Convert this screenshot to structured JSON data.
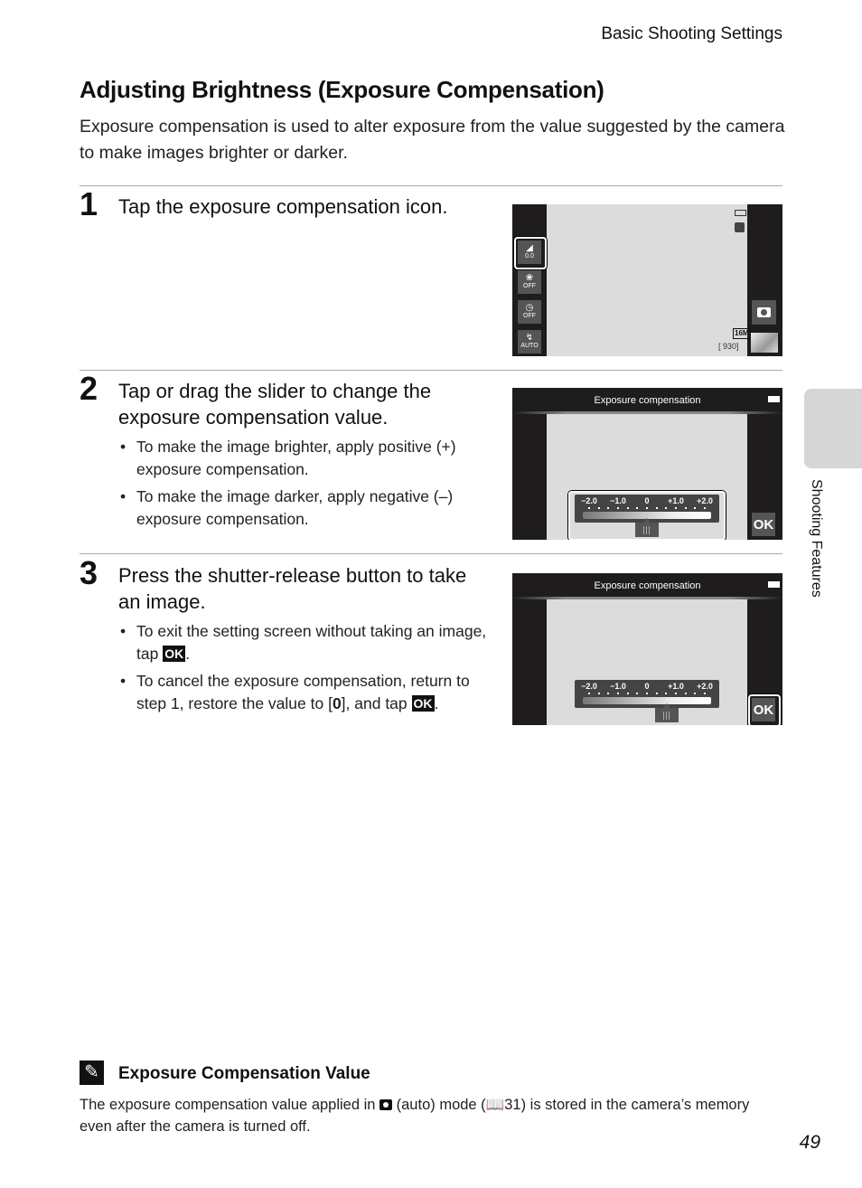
{
  "header": {
    "running_head": "Basic Shooting Settings"
  },
  "title": "Adjusting Brightness (Exposure Compensation)",
  "intro": "Exposure compensation is used to alter exposure from the value suggested by the camera to make images brighter or darker.",
  "steps": [
    {
      "number": "1",
      "title": "Tap the exposure compensation icon.",
      "bullets": [],
      "screen": {
        "left_buttons": [
          {
            "icon": "exposure-compensation-icon",
            "label": "0.0",
            "selected": true
          },
          {
            "icon": "macro-icon",
            "label": "OFF"
          },
          {
            "icon": "self-timer-icon",
            "label": "OFF"
          },
          {
            "icon": "flash-icon",
            "label": "AUTO"
          }
        ],
        "image_mode": "16M",
        "remaining_exposures": "930",
        "shoot_button": "camera-icon"
      }
    },
    {
      "number": "2",
      "title": "Tap or drag the slider to change the exposure compensation value.",
      "bullets": [
        "To make the image brighter, apply positive (+) exposure compensation.",
        "To make the image darker, apply negative (–) exposure compensation."
      ],
      "screen": {
        "header": "Exposure compensation",
        "scale_labels": [
          "−2.0",
          "−1.0",
          "0",
          "+1.0",
          "+2.0"
        ],
        "slider_value": 0.0,
        "ok_label": "OK",
        "highlight": "slider"
      }
    },
    {
      "number": "3",
      "title": "Press the shutter-release button to take an image.",
      "bullets_html": true,
      "bullet1_pre": "To exit the setting screen without taking an image, tap ",
      "bullet1_post": ".",
      "bullet2_pre": "To cancel the exposure compensation, return to step 1, restore the value to [",
      "bullet2_bold": "0",
      "bullet2_mid": "], and tap ",
      "bullet2_post": ".",
      "ok_glyph": "OK",
      "screen": {
        "header": "Exposure compensation",
        "scale_labels": [
          "−2.0",
          "−1.0",
          "0",
          "+1.0",
          "+2.0"
        ],
        "slider_value": 0.7,
        "ok_label": "OK",
        "highlight": "ok-button"
      }
    }
  ],
  "side_tab": {
    "label": "Shooting Features"
  },
  "note": {
    "icon": "pencil-note-icon",
    "title": "Exposure Compensation Value",
    "body_pre": "The exposure compensation value applied in ",
    "body_mid": " (auto) mode (",
    "page_ref": "31",
    "body_post": ") is stored in the camera’s memory even after the camera is turned off."
  },
  "page_number": "49"
}
